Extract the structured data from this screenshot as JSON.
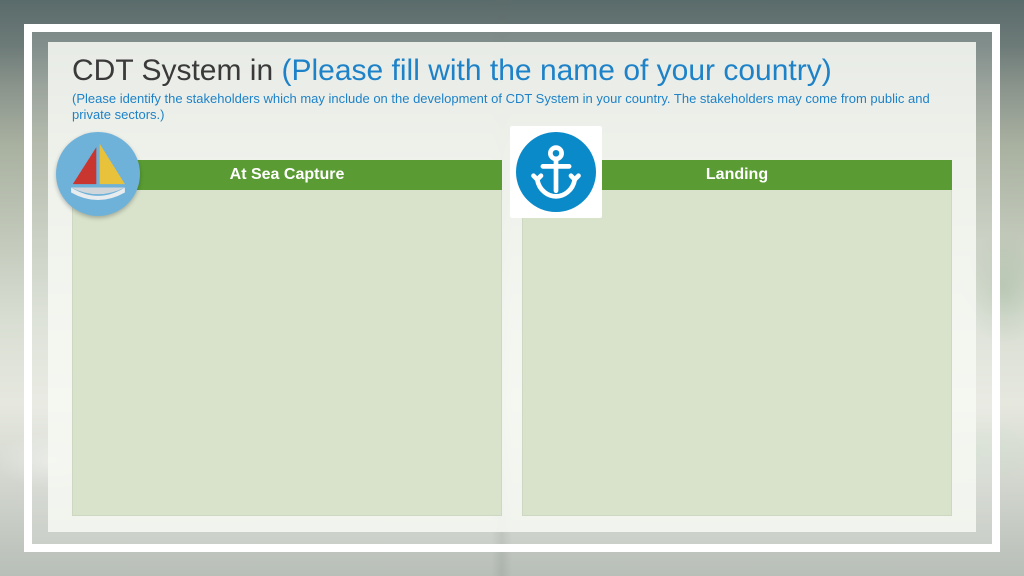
{
  "title": {
    "prefix": "CDT System in ",
    "hint": "(Please fill with the name of your country)"
  },
  "subtitle": "(Please identify the stakeholders which may include on the development of CDT System in your country. The stakeholders may come from public and private sectors.)",
  "cards": [
    {
      "label": "At Sea Capture",
      "icon": "sailboat"
    },
    {
      "label": "Landing",
      "icon": "anchor"
    }
  ],
  "colors": {
    "accent_blue": "#1e82c8",
    "header_green": "#5a9c33",
    "body_green": "#d9e3cb",
    "badge_blue": "#6fb2d9",
    "anchor_blue": "#0a8ac9"
  }
}
